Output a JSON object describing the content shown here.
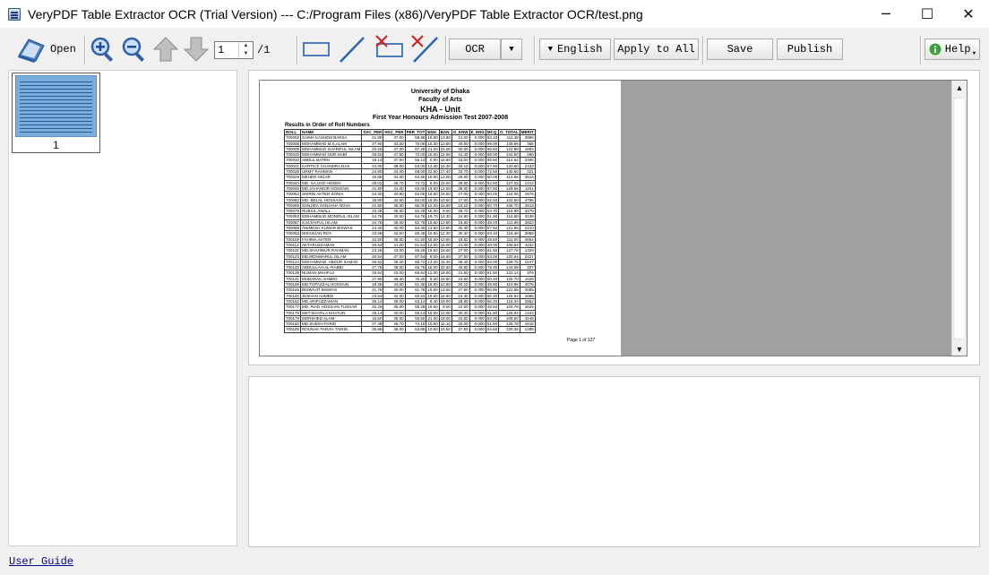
{
  "window": {
    "title": "VeryPDF Table Extractor OCR (Trial Version) --- C:/Program Files (x86)/VeryPDF Table Extractor OCR/test.png",
    "controls": {
      "minimize": "─",
      "maximize": "☐",
      "close": "✕"
    }
  },
  "toolbar": {
    "open_label": "Open",
    "page_input_value": "1",
    "page_total": "/1",
    "ocr_label": "OCR",
    "language_label": "English",
    "apply_all_label": "Apply to All",
    "save_label": "Save",
    "publish_label": "Publish",
    "help_label": "Help"
  },
  "thumbnails": [
    {
      "label": "1"
    }
  ],
  "document": {
    "university": "University of Dhaka",
    "faculty": "Faculty of Arts",
    "unit": "KHA - Unit",
    "exam": "First Year Honours Admission Test 2007-2008",
    "caption": "Results in Order of Roll Numbers",
    "page_footer": "Page 1 of 127",
    "columns": [
      "ROLL",
      "NAME",
      "SSC_PER",
      "HSC_PER",
      "PER_TOT",
      "ENG",
      "BAN",
      "G_KNW",
      "E_ENG",
      "MCQ",
      "G_TOTAL",
      "MERIT"
    ],
    "rows": [
      [
        "700002",
        "SAIMA KASHEM BARSA",
        "21.90",
        "37.00",
        "58.98",
        "18.90",
        "13.80",
        "21.00",
        "0.000",
        "53.10",
        "111.48",
        "3996"
      ],
      [
        "700008",
        "MOHAMMAD M.S.ALAM",
        "27.90",
        "43.00",
        "70.06",
        "15.30",
        "13.80",
        "40.00",
        "0.000",
        "69.00",
        "139.66",
        "365"
      ],
      [
        "700009",
        "MOHAMMAD SHARIFUL ISLAM",
        "20.28",
        "37.00",
        "57.28",
        "21.00",
        "15.00",
        "30.60",
        "0.000",
        "66.60",
        "123.88",
        "1893"
      ],
      [
        "700015",
        "MOHAMMAD NUR NABI",
        "25.50",
        "47.50",
        "73.00",
        "15.00",
        "12.60",
        "41.40",
        "0.000",
        "69.00",
        "142.00",
        "266"
      ],
      [
        "700020",
        "ABDUL BATEN",
        "19.14",
        "37.00",
        "56.14",
        "0.00",
        "16.50",
        "33.00",
        "0.000",
        "58.50",
        "114.64",
        "3490"
      ],
      [
        "700021",
        "KARTICK CHANDRA DAS",
        "24.00",
        "39.00",
        "63.00",
        "12.30",
        "15.30",
        "32.10",
        "0.000",
        "57.60",
        "120.60",
        "2433"
      ],
      [
        "700028",
        "URMY RAHMAN",
        "24.90",
        "44.00",
        "68.00",
        "22.50",
        "17.40",
        "32.70",
        "0.000",
        "72.60",
        "140.60",
        "321"
      ],
      [
        "700029",
        "MEHER NIGAR",
        "19.86",
        "34.00",
        "53.86",
        "19.50",
        "12.00",
        "28.50",
        "0.000",
        "60.00",
        "113.86",
        "3615"
      ],
      [
        "700044",
        "MD. SAJJAD HOSEN",
        "28.02",
        "46.70",
        "74.72",
        "9.00",
        "15.00",
        "28.50",
        "0.000",
        "52.50",
        "127.22",
        "1412"
      ],
      [
        "700046",
        "MD.JAHANGIR HOSSAIN",
        "21.90",
        "41.00",
        "62.06",
        "19.50",
        "12.00",
        "36.00",
        "0.000",
        "67.50",
        "129.56",
        "1151"
      ],
      [
        "700053",
        "SHIRIN AKTER SONIA",
        "24.30",
        "40.80",
        "64.06",
        "16.50",
        "16.50",
        "27.00",
        "0.000",
        "60.00",
        "124.06",
        "1876"
      ],
      [
        "700062",
        "MD. BELAL HOSSAIN",
        "18.90",
        "32.60",
        "50.00",
        "15.00",
        "10.50",
        "27.00",
        "0.000",
        "52.50",
        "102.50",
        "4786"
      ],
      [
        "700069",
        "SANJIDA SANJANA NOVA",
        "21.90",
        "35.00",
        "56.00",
        "12.00",
        "15.60",
        "23.10",
        "0.000",
        "50.70",
        "106.70",
        "4513"
      ],
      [
        "700078",
        "RUBIUL AWALL",
        "23.28",
        "39.00",
        "62.28",
        "15.00",
        "9.00",
        "29.70",
        "0.000",
        "53.70",
        "115.98",
        "3278"
      ],
      [
        "700083",
        "MOHAMMAD MONIRUL ISLAM",
        "24.78",
        "40.00",
        "64.78",
        "19.70",
        "12.30",
        "24.90",
        "0.000",
        "51.90",
        "116.68",
        "3139"
      ],
      [
        "700087",
        "S.M.SAIFUL ISLAM",
        "24.78",
        "38.00",
        "62.78",
        "15.60",
        "13.80",
        "19.80",
        "0.000",
        "49.20",
        "111.98",
        "3923"
      ],
      [
        "700088",
        "ANIMESH KUMAR BISWAS",
        "24.30",
        "40.00",
        "64.36",
        "13.50",
        "13.80",
        "30.30",
        "0.000",
        "57.60",
        "121.96",
        "2210"
      ],
      [
        "700093",
        "NIRANJAN ROY",
        "23.28",
        "42.00",
        "65.28",
        "10.50",
        "12.30",
        "30.30",
        "0.000",
        "53.10",
        "118.38",
        "2859"
      ],
      [
        "700109",
        "FAHIMA AKTER",
        "22.50",
        "39.00",
        "61.50",
        "19.50",
        "10.50",
        "19.50",
        "0.000",
        "49.50",
        "111.00",
        "4054"
      ],
      [
        "700112",
        "AKTARUZZAMAN",
        "20.64",
        "41.00",
        "61.64",
        "12.00",
        "15.00",
        "21.00",
        "0.000",
        "48.00",
        "109.64",
        "4232"
      ],
      [
        "700118",
        "MD.SHAHINUR RAHMAN",
        "23.28",
        "43.00",
        "66.28",
        "16.50",
        "18.00",
        "27.00",
        "0.000",
        "61.50",
        "127.78",
        "1329"
      ],
      [
        "700123",
        "MD.MONWARUL ISLAM",
        "20.64",
        "37.00",
        "57.64",
        "9.00",
        "16.50",
        "37.50",
        "0.000",
        "63.00",
        "120.64",
        "2427"
      ],
      [
        "700124",
        "MOHAMMAD. ABDUR SAMAD",
        "26.52",
        "39.20",
        "65.72",
        "13.20",
        "11.40",
        "38.40",
        "0.000",
        "63.00",
        "128.72",
        "1247"
      ],
      [
        "700132",
        "ABDULLAH-AL-RABBI",
        "27.78",
        "38.00",
        "65.78",
        "15.00",
        "22.50",
        "40.80",
        "0.000",
        "78.30",
        "144.08",
        "207"
      ],
      [
        "700139",
        "NUMAN MAHFUJ",
        "26.64",
        "43.00",
        "69.64",
        "12.00",
        "18.00",
        "31.50",
        "0.000",
        "61.50",
        "131.14",
        "976"
      ],
      [
        "700141",
        "MUBARAK AHMED",
        "27.90",
        "48.30",
        "75.30",
        "9.30",
        "16.50",
        "24.60",
        "0.000",
        "50.40",
        "125.70",
        "1628"
      ],
      [
        "700155",
        "MD.TOFAZZAL HOSSAIN",
        "18.36",
        "43.00",
        "61.36",
        "18.90",
        "10.50",
        "20.10",
        "0.000",
        "49.50",
        "110.86",
        "4076"
      ],
      [
        "700156",
        "BISWAJIT BISWAS",
        "21.78",
        "40.00",
        "61.78",
        "19.50",
        "13.50",
        "27.90",
        "0.000",
        "60.90",
        "122.68",
        "2085"
      ],
      [
        "700160",
        "JESHAN AHMED",
        "23.64",
        "42.00",
        "65.64",
        "19.50",
        "16.50",
        "24.30",
        "0.000",
        "60.30",
        "125.94",
        "1586"
      ],
      [
        "700162",
        "MD.ARIFUZZAMAN",
        "26.14",
        "38.00",
        "63.14",
        "8.40",
        "18.00",
        "28.80",
        "0.000",
        "56.20",
        "118.34",
        "2852"
      ],
      [
        "700177",
        "MD. RIAD HOSSAIN TUSHAR",
        "20.28",
        "35.00",
        "55.28",
        "19.50",
        "9.00",
        "22.50",
        "0.000",
        "49.50",
        "104.78",
        "4626"
      ],
      [
        "700178",
        "MST.SHAFILA KHATUN",
        "25.14",
        "40.00",
        "65.14",
        "19.50",
        "12.00",
        "30.30",
        "0.000",
        "61.80",
        "126.94",
        "1444"
      ],
      [
        "700179",
        "MORSHED ALAM",
        "16.50",
        "39.00",
        "55.50",
        "21.00",
        "18.00",
        "22.50",
        "0.000",
        "54.00",
        "109.50",
        "4245"
      ],
      [
        "700180",
        "MD.SHEKH FARID",
        "27.48",
        "46.70",
        "74.18",
        "10.50",
        "11.10",
        "30.00",
        "0.000",
        "51.60",
        "125.78",
        "1615"
      ],
      [
        "700185",
        "ROUNAK FARAH TAIRIN",
        "25.86",
        "38.00",
        "63.86",
        "10.50",
        "16.50",
        "37.50",
        "0.000",
        "64.50",
        "128.36",
        "1289"
      ]
    ]
  },
  "status": {
    "user_guide_label": "User Guide"
  }
}
